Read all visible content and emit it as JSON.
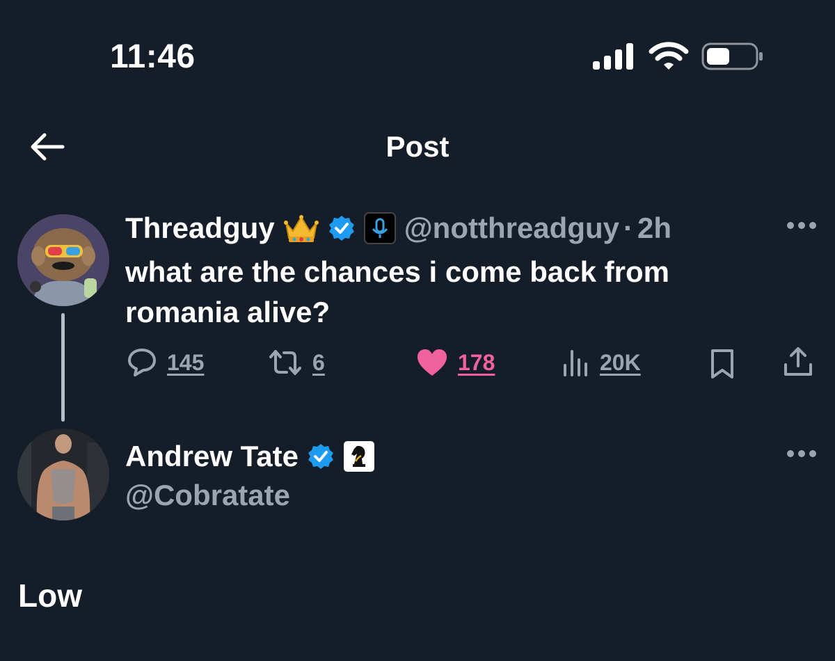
{
  "status_bar": {
    "time": "11:46",
    "icons": [
      "signal-icon",
      "wifi-icon",
      "battery-icon"
    ]
  },
  "header": {
    "title": "Post",
    "back_icon": "arrow-left-icon"
  },
  "post": {
    "display_name": "Threadguy",
    "badges": [
      "crown-emoji",
      "verified-badge-icon",
      "podcast-badge-icon"
    ],
    "handle": "@notthreadguy",
    "separator": "·",
    "time_ago": "2h",
    "text": "what are the chances i come back from romania alive?",
    "actions": {
      "replies": "145",
      "reposts": "6",
      "likes": "178",
      "views": "20K"
    },
    "colors": {
      "like": "#f0629e",
      "verified": "#1d9bf0",
      "muted": "#9ba5b1"
    }
  },
  "reply": {
    "display_name": "Andrew Tate",
    "badges": [
      "verified-badge-icon",
      "chess-knight-badge-icon"
    ],
    "handle": "@Cobratate",
    "text": "Low"
  },
  "theme": {
    "background": "#151d28",
    "text": "#ffffff"
  }
}
